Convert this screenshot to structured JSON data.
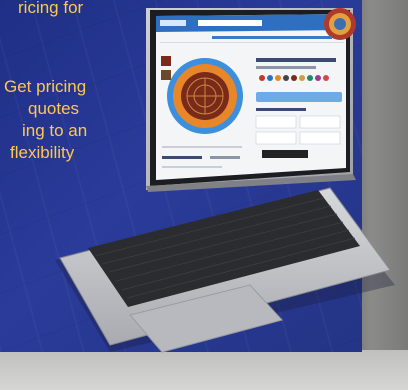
{
  "promo": {
    "line1": "ricing for",
    "line2": "Get pricing",
    "line3": "quotes",
    "line4": "ing to an",
    "line5": "flexibility"
  },
  "colors": {
    "panel": "#2a3b9a",
    "promo_text": "#ffc84a",
    "laptop_body": "#c9cbd0",
    "keyboard": "#2b2c30",
    "site_header": "#2f6fc0",
    "rug_outer": "#3b8fdc",
    "rug_inner": "#e8872a",
    "rug_center": "#7a2a1a"
  },
  "icons": [
    "laptop",
    "rug-image"
  ]
}
